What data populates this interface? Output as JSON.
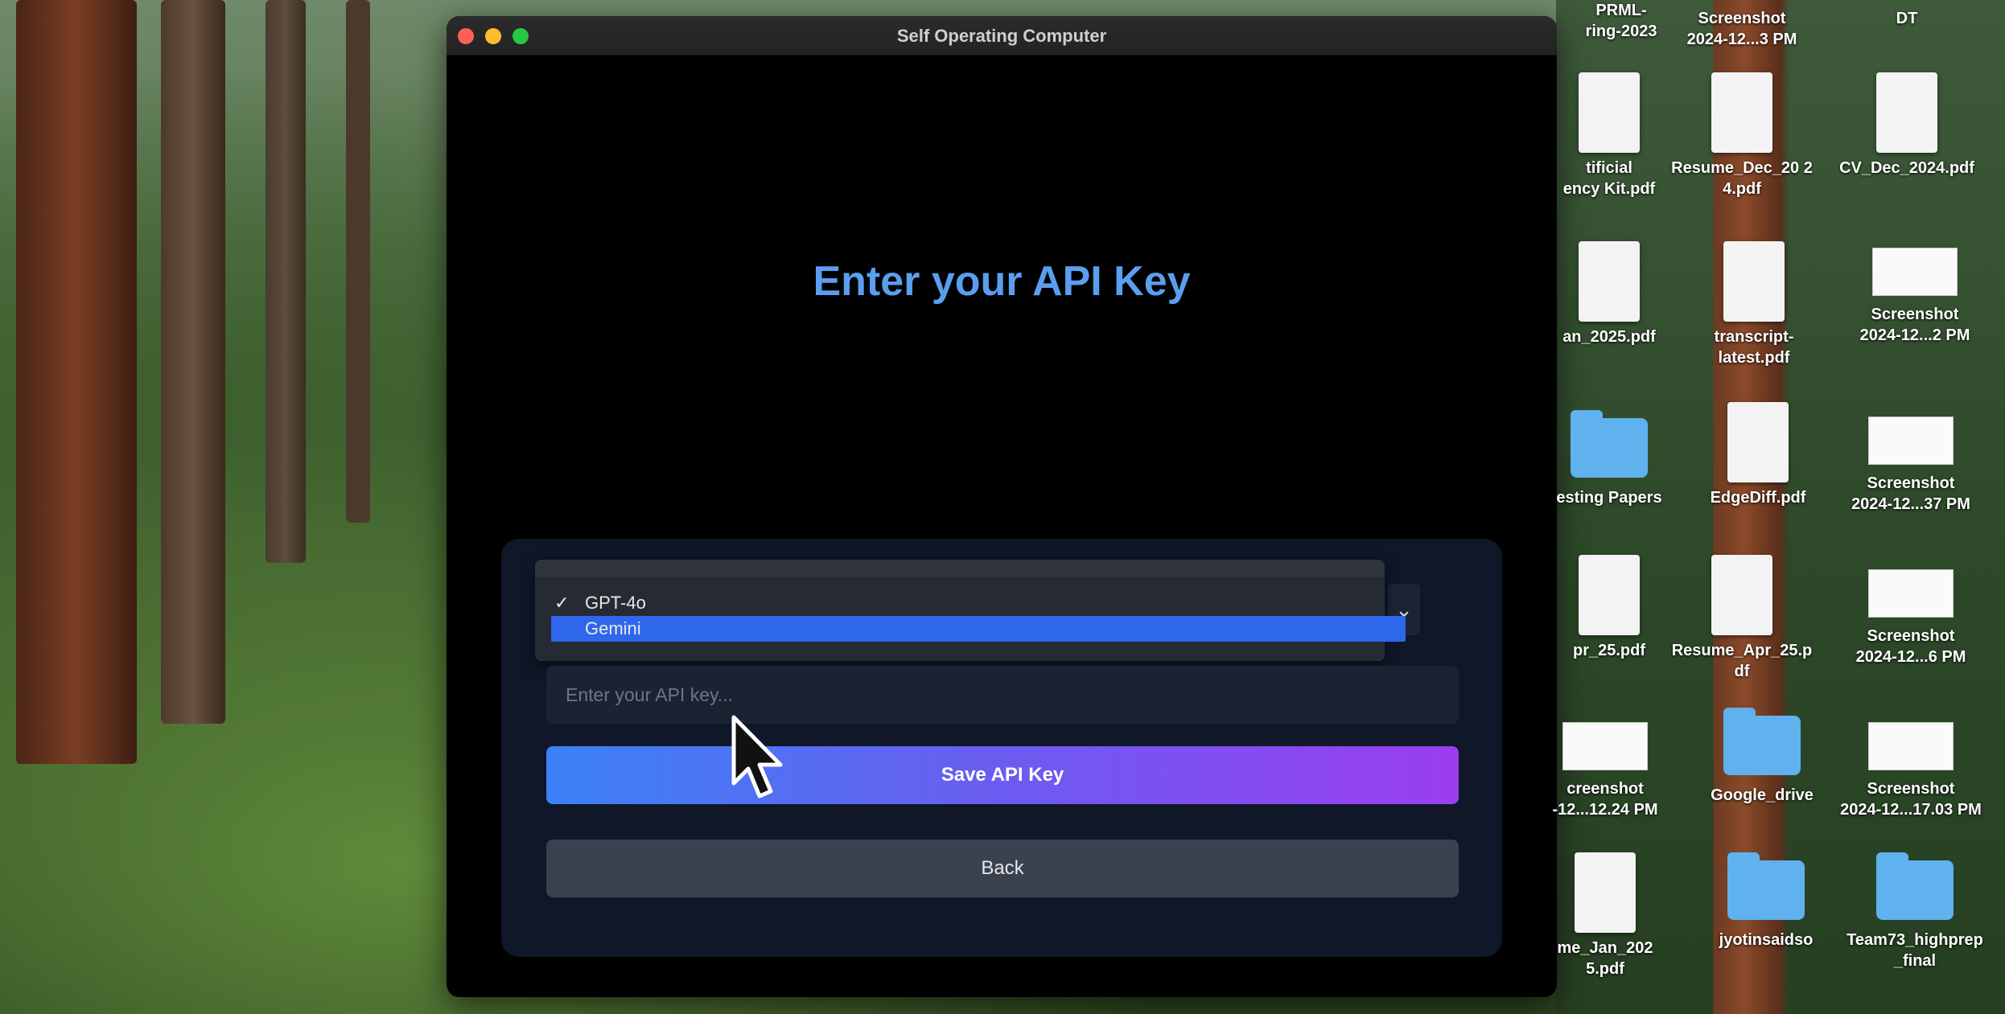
{
  "window": {
    "title": "Self Operating Computer",
    "heading": "Enter your API Key"
  },
  "model_select": {
    "selected": "GPT-4o",
    "options": [
      "GPT-4o",
      "Gemini"
    ],
    "highlighted": "Gemini"
  },
  "api_key": {
    "placeholder": "Enter your API key..."
  },
  "buttons": {
    "save": "Save API Key",
    "back": "Back"
  },
  "desktop_icons": [
    {
      "label": "PRML-\nring-2023",
      "kind": "text"
    },
    {
      "label": "Screenshot\n2024-12...3 PM",
      "kind": "text"
    },
    {
      "label": "DT",
      "kind": "text"
    },
    {
      "label": "tificial\nency Kit.pdf",
      "kind": "doc"
    },
    {
      "label": "Resume_Dec_20 2\n4.pdf",
      "kind": "doc"
    },
    {
      "label": "CV_Dec_2024.pdf",
      "kind": "doc"
    },
    {
      "label": "an_2025.pdf",
      "kind": "doc"
    },
    {
      "label": "transcript-\nlatest.pdf",
      "kind": "doc"
    },
    {
      "label": "Screenshot\n2024-12...2 PM",
      "kind": "shot"
    },
    {
      "label": "esting Papers",
      "kind": "folder"
    },
    {
      "label": "EdgeDiff.pdf",
      "kind": "doc"
    },
    {
      "label": "Screenshot\n2024-12...37 PM",
      "kind": "shot"
    },
    {
      "label": "pr_25.pdf",
      "kind": "doc"
    },
    {
      "label": "Resume_Apr_25.p\ndf",
      "kind": "doc"
    },
    {
      "label": "Screenshot\n2024-12...6 PM",
      "kind": "shot"
    },
    {
      "label": "creenshot\n-12...12.24 PM",
      "kind": "shot"
    },
    {
      "label": "Google_drive",
      "kind": "folder"
    },
    {
      "label": "Screenshot\n2024-12...17.03 PM",
      "kind": "shot"
    },
    {
      "label": "me_Jan_202\n5.pdf",
      "kind": "doc"
    },
    {
      "label": "jyotinsaidso",
      "kind": "folder"
    },
    {
      "label": "Team73_highprep\n_final",
      "kind": "folder"
    }
  ],
  "colors": {
    "heading": "#5a9ef0",
    "highlight": "#2f67ec",
    "save_gradient_start": "#3b82f6",
    "save_gradient_end": "#9b3ef0"
  }
}
